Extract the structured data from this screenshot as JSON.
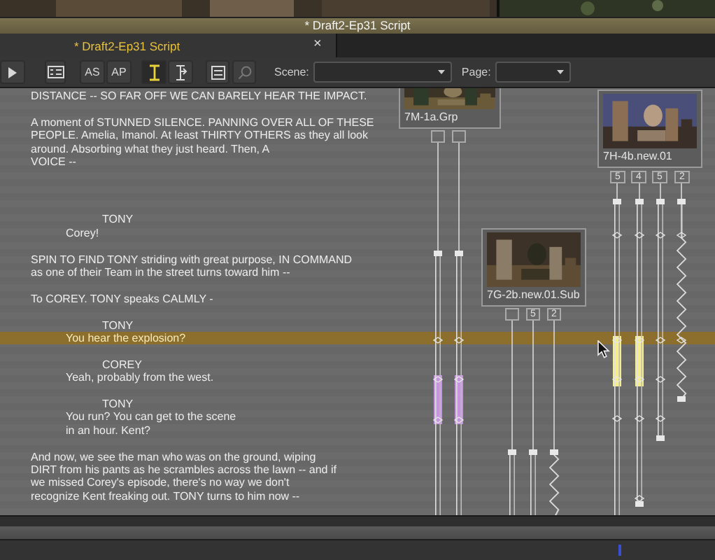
{
  "window": {
    "title": "* Draft2-Ep31 Script"
  },
  "tabs": [
    {
      "label": "* Draft2-Ep31 Script",
      "selected": true,
      "close": "×"
    }
  ],
  "toolbar": {
    "tools": [
      {
        "kind": "play",
        "selected": false,
        "disabled": false
      },
      {
        "kind": "list",
        "selected": false,
        "disabled": false
      },
      {
        "kind": "text",
        "label": "AS",
        "selected": false,
        "disabled": false
      },
      {
        "kind": "text",
        "label": "AP",
        "selected": false,
        "disabled": false
      },
      {
        "kind": "ibeam",
        "selected": true,
        "disabled": false
      },
      {
        "kind": "split",
        "selected": false,
        "disabled": false
      },
      {
        "kind": "page",
        "selected": false,
        "disabled": false
      },
      {
        "kind": "search",
        "selected": false,
        "disabled": true
      }
    ],
    "scene": {
      "label": "Scene:"
    },
    "page": {
      "label": "Page:"
    }
  },
  "script": {
    "sections": [
      {
        "blocks": [
          {
            "kind": "action",
            "lines": [
              "DISTANCE -- SO FAR OFF WE CAN BARELY HEAR THE IMPACT."
            ],
            "selected": false
          },
          {
            "kind": "action",
            "lines": [
              "A moment of STUNNED SILENCE. PANNING OVER ALL OF THESE",
              "PEOPLE. Amelia, Imanol. At least THIRTY OTHERS as they all look",
              "around. Absorbing what they just heard. Then, A",
              "VOICE --"
            ],
            "selected": false
          }
        ]
      },
      {
        "blocks": [
          {
            "kind": "character",
            "lines": [
              "TONY"
            ],
            "selected": false
          },
          {
            "kind": "dialogue",
            "lines": [
              "Corey!"
            ],
            "selected": false
          },
          {
            "kind": "action",
            "lines": [
              "SPIN TO FIND TONY striding with great purpose, IN COMMAND",
              "as one of their Team in the street turns toward him --"
            ],
            "selected": false
          },
          {
            "kind": "action",
            "lines": [
              "To COREY. TONY speaks CALMLY -"
            ],
            "selected": false
          },
          {
            "kind": "character",
            "lines": [
              "TONY"
            ],
            "selected": false
          },
          {
            "kind": "dialogue",
            "lines": [
              "You hear the explosion?"
            ],
            "selected": true
          },
          {
            "kind": "character",
            "lines": [
              "COREY"
            ],
            "selected": false
          },
          {
            "kind": "dialogue",
            "lines": [
              "Yeah, probably from the west."
            ],
            "selected": false
          },
          {
            "kind": "character",
            "lines": [
              "TONY"
            ],
            "selected": false
          },
          {
            "kind": "dialogue",
            "lines": [
              "You run? You can get to the scene",
              "in an hour. Kent?"
            ],
            "selected": false
          },
          {
            "kind": "action",
            "lines": [
              "And now, we see the man who was on the ground, wiping",
              "DIRT from his pants as he scrambles across the lawn -- and if",
              "we missed Corey's episode, there's no way we don't",
              "recognize Kent freaking out. TONY turns to him now --"
            ],
            "selected": false
          }
        ]
      }
    ]
  },
  "clips": [
    {
      "name": "7M-1a.Grp",
      "tracks": [
        {
          "kind": "line",
          "color": "#c893e0"
        },
        {
          "kind": "line",
          "color": "#c893e0"
        }
      ]
    },
    {
      "name": "7H-4b.new.01",
      "tracks": [
        {
          "label": "5",
          "kind": "line",
          "color": "#f4ee8c"
        },
        {
          "label": "4",
          "kind": "line",
          "color": "#f4ee8c"
        },
        {
          "label": "5",
          "kind": "line"
        },
        {
          "label": "2",
          "kind": "zigzag"
        }
      ]
    },
    {
      "name": "7G-2b.new.01.Sub",
      "tracks": [
        {
          "kind": "line"
        },
        {
          "label": "5",
          "kind": "line"
        },
        {
          "label": "2",
          "kind": "zigzag"
        }
      ]
    }
  ]
}
